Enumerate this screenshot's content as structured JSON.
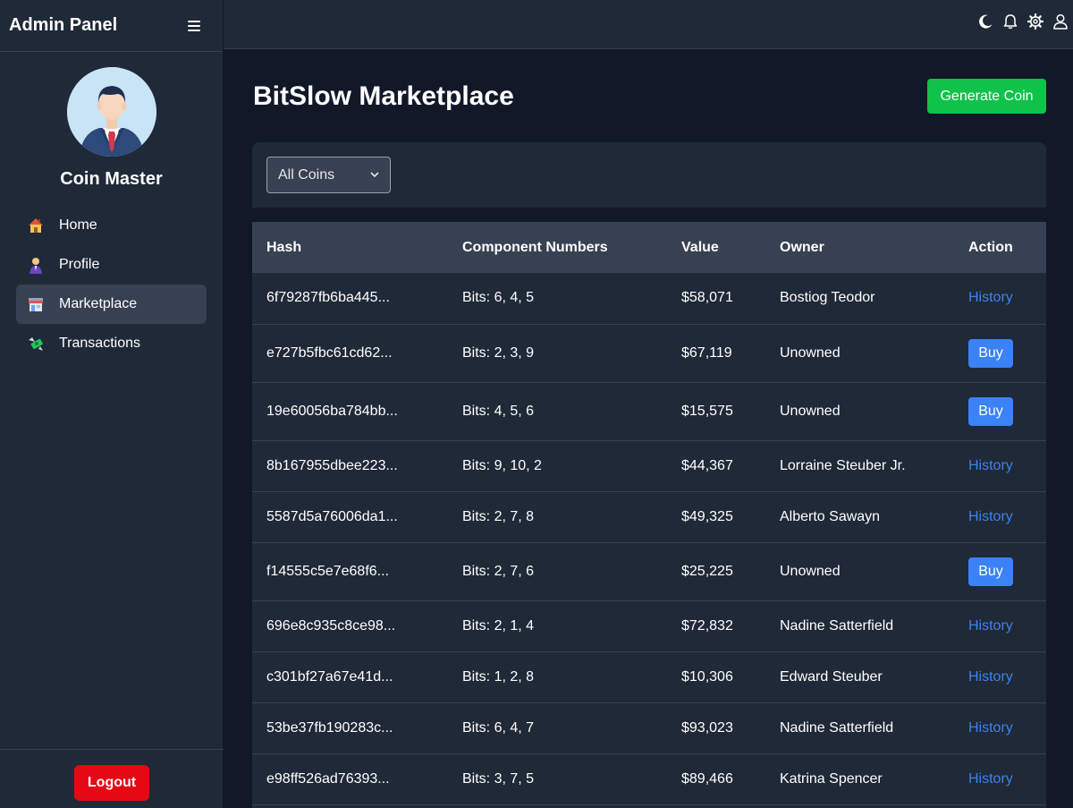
{
  "sidebar": {
    "brand": "Admin Panel",
    "profile_name": "Coin Master",
    "items": [
      {
        "label": "Home",
        "icon": "house-icon"
      },
      {
        "label": "Profile",
        "icon": "person-icon"
      },
      {
        "label": "Marketplace",
        "icon": "store-icon",
        "active": true
      },
      {
        "label": "Transactions",
        "icon": "money-wings-icon"
      }
    ],
    "logout_label": "Logout"
  },
  "topbar": {
    "icons": [
      "moon-icon",
      "bell-icon",
      "gear-icon",
      "user-icon"
    ]
  },
  "main": {
    "title": "BitSlow Marketplace",
    "generate_label": "Generate Coin",
    "filter_selected": "All Coins",
    "columns": [
      "Hash",
      "Component Numbers",
      "Value",
      "Owner",
      "Action"
    ],
    "rows": [
      {
        "hash": "6f79287fb6ba445...",
        "components": "Bits: 6, 4, 5",
        "value": "$58,071",
        "owner": "Bostiog Teodor",
        "action": "History"
      },
      {
        "hash": "e727b5fbc61cd62...",
        "components": "Bits: 2, 3, 9",
        "value": "$67,119",
        "owner": "Unowned",
        "action": "Buy"
      },
      {
        "hash": "19e60056ba784bb...",
        "components": "Bits: 4, 5, 6",
        "value": "$15,575",
        "owner": "Unowned",
        "action": "Buy"
      },
      {
        "hash": "8b167955dbee223...",
        "components": "Bits: 9, 10, 2",
        "value": "$44,367",
        "owner": "Lorraine Steuber Jr.",
        "action": "History"
      },
      {
        "hash": "5587d5a76006da1...",
        "components": "Bits: 2, 7, 8",
        "value": "$49,325",
        "owner": "Alberto Sawayn",
        "action": "History"
      },
      {
        "hash": "f14555c5e7e68f6...",
        "components": "Bits: 2, 7, 6",
        "value": "$25,225",
        "owner": "Unowned",
        "action": "Buy"
      },
      {
        "hash": "696e8c935c8ce98...",
        "components": "Bits: 2, 1, 4",
        "value": "$72,832",
        "owner": "Nadine Satterfield",
        "action": "History"
      },
      {
        "hash": "c301bf27a67e41d...",
        "components": "Bits: 1, 2, 8",
        "value": "$10,306",
        "owner": "Edward Steuber",
        "action": "History"
      },
      {
        "hash": "53be37fb190283c...",
        "components": "Bits: 6, 4, 7",
        "value": "$93,023",
        "owner": "Nadine Satterfield",
        "action": "History"
      },
      {
        "hash": "e98ff526ad76393...",
        "components": "Bits: 3, 7, 5",
        "value": "$89,466",
        "owner": "Katrina Spencer",
        "action": "History"
      }
    ]
  },
  "colors": {
    "sidebar_bg": "#1f2937",
    "main_bg": "#111827",
    "accent_blue": "#3b82f6",
    "generate_green": "#0ec24a",
    "logout_red": "#e50914"
  }
}
